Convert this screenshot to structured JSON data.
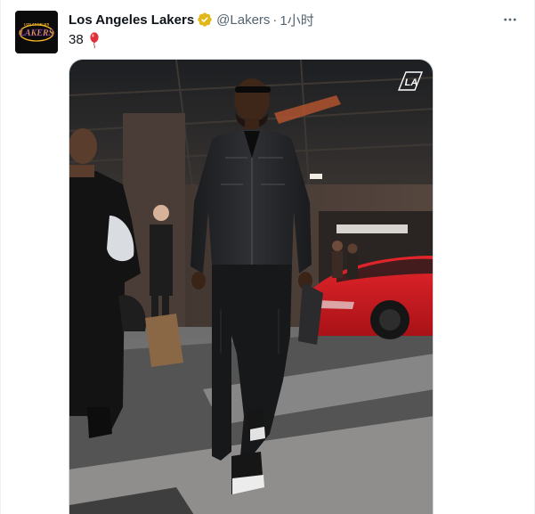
{
  "tweet": {
    "display_name": "Los Angeles Lakers",
    "handle": "@Lakers",
    "separator": "·",
    "time": "1小时",
    "text": "38",
    "avatar_logo_text": "LAKERS",
    "avatar_logo_city": "LOS ANGELES",
    "media_watermark": "LA"
  },
  "icons": {
    "verified": "verified-badge-icon",
    "more": "more-options-icon",
    "balloon": "balloon-emoji"
  },
  "colors": {
    "verified_gold": "#e2b719",
    "lakers_purple": "#552583",
    "lakers_gold": "#fdb927",
    "text_primary": "#0f1419",
    "text_secondary": "#536471",
    "car_red": "#c8161d"
  }
}
